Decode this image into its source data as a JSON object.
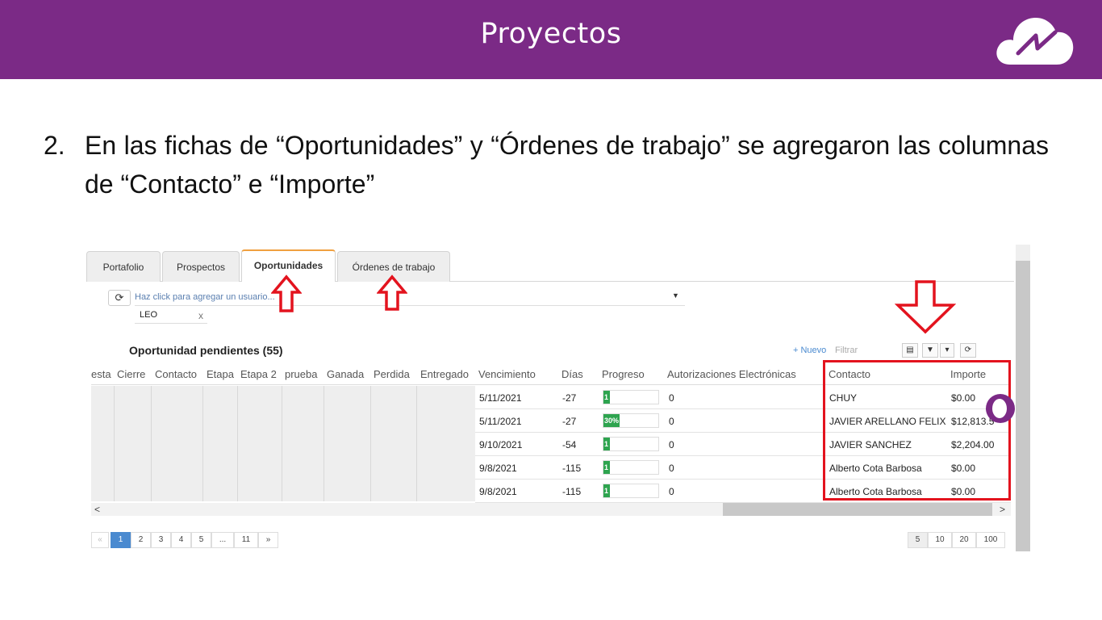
{
  "header": {
    "title": "Proyectos",
    "logo_icon": "cloud-logo-icon",
    "color": "#7b2a86"
  },
  "step": {
    "number": "2.",
    "text": "En las fichas de “Oportunidades” y “Órdenes de trabajo” se agregaron las columnas de “Contacto” e “Importe”"
  },
  "app": {
    "tabs": [
      {
        "label": "Portafolio"
      },
      {
        "label": "Prospectos"
      },
      {
        "label": "Oportunidades",
        "active": true
      },
      {
        "label": "Órdenes de trabajo"
      }
    ],
    "refresh_icon": "refresh-icon",
    "user_filter": {
      "placeholder": "Haz click para agregar un usuario...",
      "chip": "LEO",
      "chip_remove": "x"
    },
    "section_title": "Oportunidad pendientes (55)",
    "toolbar": {
      "new_label": "+ Nuevo",
      "filter_label": "Filtrar",
      "icons": [
        "export-icon",
        "filter-icon",
        "caret-down-icon",
        "refresh-icon"
      ]
    },
    "columns": {
      "frozen": [
        "esta",
        "Cierre",
        "Contacto",
        "Etapa",
        "Etapa 2",
        "prueba",
        "Ganada",
        "Perdida",
        "Entregado"
      ],
      "main": [
        "Vencimiento",
        "Días",
        "Progreso",
        "Autorizaciones Electrónicas",
        "Contacto",
        "Importe"
      ]
    },
    "rows": [
      {
        "vencimiento": "5/11/2021",
        "dias": "-27",
        "progreso_label": "1",
        "progreso_pct": 1,
        "autorizaciones": "0",
        "contacto": "CHUY",
        "importe": "$0.00"
      },
      {
        "vencimiento": "5/11/2021",
        "dias": "-27",
        "progreso_label": "30%",
        "progreso_pct": 30,
        "autorizaciones": "0",
        "contacto": "JAVIER ARELLANO FELIX",
        "importe": "$12,813.5"
      },
      {
        "vencimiento": "9/10/2021",
        "dias": "-54",
        "progreso_label": "1",
        "progreso_pct": 1,
        "autorizaciones": "0",
        "contacto": "JAVIER SANCHEZ",
        "importe": "$2,204.00"
      },
      {
        "vencimiento": "9/8/2021",
        "dias": "-115",
        "progreso_label": "1",
        "progreso_pct": 1,
        "autorizaciones": "0",
        "contacto": "Alberto Cota Barbosa",
        "importe": "$0.00"
      },
      {
        "vencimiento": "9/8/2021",
        "dias": "-115",
        "progreso_label": "1",
        "progreso_pct": 1,
        "autorizaciones": "0",
        "contacto": "Alberto Cota Barbosa",
        "importe": "$0.00"
      }
    ],
    "pagination": {
      "prev": "«",
      "next": "»",
      "pages": [
        "1",
        "2",
        "3",
        "4",
        "5",
        "...",
        "11"
      ],
      "current": "1",
      "page_sizes": [
        "5",
        "10",
        "20",
        "100"
      ],
      "current_size": "5"
    },
    "scroll_left": "<",
    "scroll_right": ">"
  },
  "annotations": {
    "arrow_color": "#e3131e",
    "arrow_icons": [
      "up-arrow-icon",
      "up-arrow-icon",
      "down-arrow-icon"
    ]
  }
}
